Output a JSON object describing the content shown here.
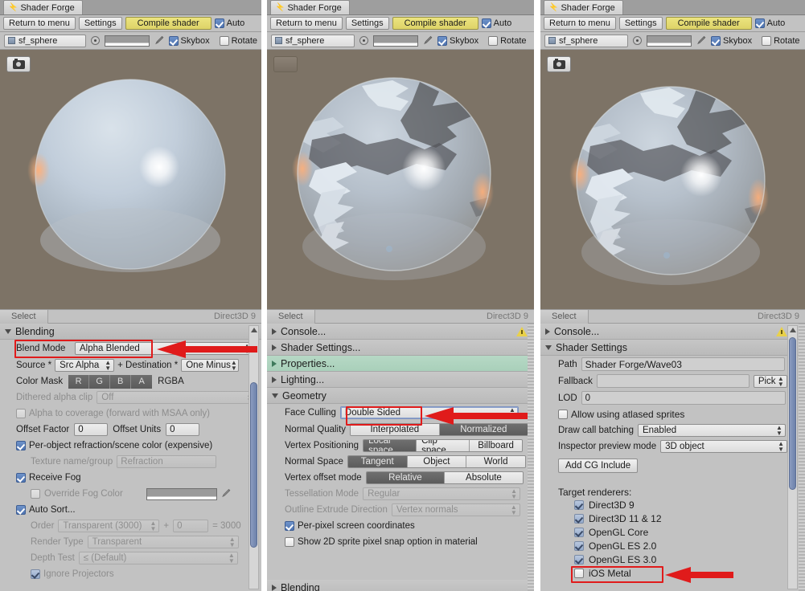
{
  "window": {
    "tab_title": "Shader Forge",
    "tab_icon": "lightning-icon"
  },
  "toolbar": {
    "return_label": "Return to menu",
    "settings_label": "Settings",
    "compile_label": "Compile shader",
    "auto_label": "Auto",
    "auto_checked": true
  },
  "objectbar": {
    "object_name": "sf_sphere",
    "skybox_label": "Skybox",
    "skybox_checked": true,
    "rotate_label": "Rotate",
    "rotate_checked": false,
    "radio_icon": "target-icon",
    "eyedropper_icon": "eyedropper-icon",
    "cube_icon": "mesh-cube-icon"
  },
  "statusbar": {
    "select_label": "Select",
    "api_label": "Direct3D 9"
  },
  "panels": [
    {
      "id": "left",
      "preview": {
        "camera_button": true,
        "style": "opaque-sphere"
      },
      "sections": [
        {
          "label": "Blending",
          "state": "open"
        }
      ],
      "blending": {
        "blend_mode_label": "Blend Mode",
        "blend_mode_value": "Alpha Blended",
        "source_label": "Source *",
        "source_value": "Src Alpha",
        "destination_label": "+ Destination *",
        "destination_value": "One Minus",
        "color_mask_label": "Color Mask",
        "color_mask_channels": [
          "R",
          "G",
          "B",
          "A"
        ],
        "color_mask_value": "RGBA",
        "dithered_label": "Dithered alpha clip",
        "dithered_value": "Off",
        "alpha_coverage_label": "Alpha to coverage (forward with MSAA only)",
        "alpha_coverage_checked": false,
        "offset_factor_label": "Offset Factor",
        "offset_factor_value": "0",
        "offset_units_label": "Offset Units",
        "offset_units_value": "0",
        "per_object_refraction_label": "Per-object refraction/scene color (expensive)",
        "per_object_refraction_checked": true,
        "texture_name_label": "Texture name/group",
        "texture_name_value": "Refraction",
        "receive_fog_label": "Receive Fog",
        "receive_fog_checked": true,
        "override_fog_label": "Override Fog Color",
        "override_fog_checked": false,
        "auto_sort_label": "Auto Sort...",
        "auto_sort_checked": true,
        "order_label": "Order",
        "order_value": "Transparent (3000)",
        "order_plus": "+",
        "order_offset": "0",
        "order_equals": "= 3000",
        "render_type_label": "Render Type",
        "render_type_value": "Transparent",
        "depth_test_label": "Depth Test",
        "depth_test_value": "≤ (Default)",
        "ignore_projectors_label": "Ignore Projectors",
        "ignore_projectors_checked": true
      }
    },
    {
      "id": "mid",
      "preview": {
        "camera_button": false,
        "style": "translucent-sphere"
      },
      "sections": [
        {
          "label": "Console...",
          "state": "closed",
          "warning": true
        },
        {
          "label": "Shader Settings...",
          "state": "closed"
        },
        {
          "label": "Properties...",
          "state": "closed",
          "highlight": "green"
        },
        {
          "label": "Lighting...",
          "state": "closed"
        },
        {
          "label": "Geometry",
          "state": "open"
        },
        {
          "label": "Blending",
          "state": "closed"
        }
      ],
      "geometry": {
        "face_culling_label": "Face Culling",
        "face_culling_value": "Double Sided",
        "normal_quality_label": "Normal Quality",
        "normal_quality_options": [
          "Interpolated",
          "Normalized"
        ],
        "normal_quality_selected": "Normalized",
        "vertex_positioning_label": "Vertex Positioning",
        "vertex_positioning_options": [
          "Local space",
          "Clip space",
          "Billboard"
        ],
        "vertex_positioning_selected": "Local space",
        "normal_space_label": "Normal Space",
        "normal_space_options": [
          "Tangent",
          "Object",
          "World"
        ],
        "normal_space_selected": "Tangent",
        "vertex_offset_label": "Vertex offset mode",
        "vertex_offset_options": [
          "Relative",
          "Absolute"
        ],
        "vertex_offset_selected": "Relative",
        "tessellation_label": "Tessellation Mode",
        "tessellation_value": "Regular",
        "outline_label": "Outline Extrude Direction",
        "outline_value": "Vertex normals",
        "per_pixel_label": "Per-pixel screen coordinates",
        "per_pixel_checked": true,
        "sprite_snap_label": "Show 2D sprite pixel snap option in material",
        "sprite_snap_checked": false
      }
    },
    {
      "id": "right",
      "preview": {
        "camera_button": true,
        "style": "translucent-sphere"
      },
      "sections": [
        {
          "label": "Console...",
          "state": "closed",
          "warning": true
        },
        {
          "label": "Shader Settings",
          "state": "open"
        }
      ],
      "shader_settings": {
        "path_label": "Path",
        "path_value": "Shader Forge/Wave03",
        "fallback_label": "Fallback",
        "fallback_value": "",
        "fallback_pick_label": "Pick",
        "lod_label": "LOD",
        "lod_value": "0",
        "atlased_label": "Allow using atlased sprites",
        "atlased_checked": false,
        "batching_label": "Draw call batching",
        "batching_value": "Enabled",
        "preview_mode_label": "Inspector preview mode",
        "preview_mode_value": "3D object",
        "add_cg_include_label": "Add CG Include",
        "target_renderers_label": "Target renderers:",
        "renderers": [
          {
            "label": "Direct3D 9",
            "checked": true
          },
          {
            "label": "Direct3D 11 & 12",
            "checked": true
          },
          {
            "label": "OpenGL Core",
            "checked": true
          },
          {
            "label": "OpenGL ES 2.0",
            "checked": true
          },
          {
            "label": "OpenGL ES 3.0",
            "checked": true
          },
          {
            "label": "iOS Metal",
            "checked": false
          }
        ]
      }
    }
  ],
  "annotations": {
    "highlight_color": "#e01b1b",
    "items": [
      {
        "name": "blend-mode-highlight",
        "target": "Blend Mode / Alpha Blended"
      },
      {
        "name": "face-culling-highlight",
        "target": "Face Culling / Double Sided"
      },
      {
        "name": "opengl-es-30-highlight",
        "target": "OpenGL ES 3.0"
      }
    ]
  },
  "colors": {
    "panel_bg": "#c2c2c2",
    "viewport_bg": "#7d7366",
    "compile_btn": "#e3da72",
    "properties_row": "#aed0bd",
    "scrollbar_thumb": "#7689ae",
    "annotation_red": "#e01b1b"
  }
}
